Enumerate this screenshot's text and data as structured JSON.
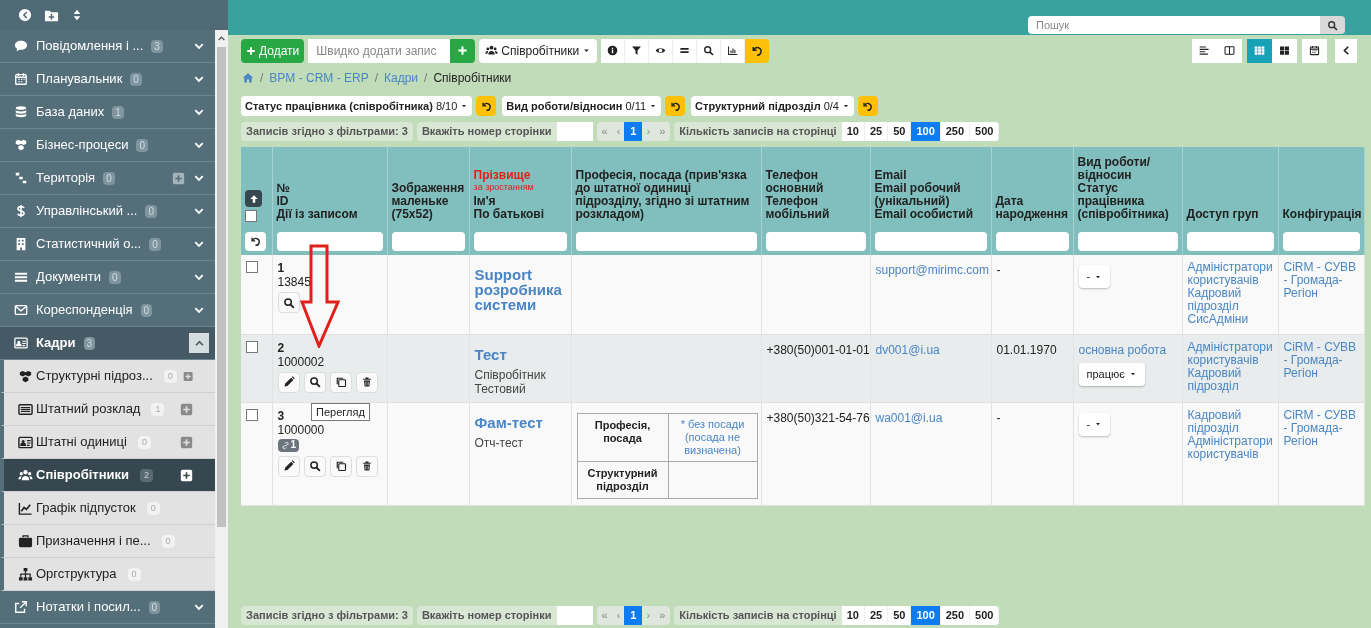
{
  "topbar": {
    "search_placeholder": "Пошук"
  },
  "sidebar": {
    "items": [
      {
        "label": "Повідомлення і ...",
        "count": "3",
        "expanded": false,
        "add": false
      },
      {
        "label": "Планувальник",
        "count": "0",
        "expanded": false,
        "add": false
      },
      {
        "label": "База даних",
        "count": "1",
        "expanded": false,
        "add": false
      },
      {
        "label": "Бізнес-процеси",
        "count": "0",
        "expanded": false,
        "add": false
      },
      {
        "label": "Територія",
        "count": "0",
        "expanded": false,
        "add": true
      },
      {
        "label": "Управлінський ...",
        "count": "0",
        "expanded": false,
        "add": false
      },
      {
        "label": "Статистичний о...",
        "count": "0",
        "expanded": false,
        "add": false
      },
      {
        "label": "Документи",
        "count": "0",
        "expanded": false,
        "add": false
      },
      {
        "label": "Кореспонденція",
        "count": "0",
        "expanded": false,
        "add": false
      },
      {
        "label": "Кадри",
        "count": "3",
        "expanded": true,
        "add": false,
        "children": [
          {
            "label": "Структурні підроз...",
            "count": "0",
            "add": true,
            "selected": false
          },
          {
            "label": "Штатний розклад",
            "count": "1",
            "add": true,
            "selected": false
          },
          {
            "label": "Штатні одиниці",
            "count": "0",
            "add": true,
            "selected": false
          },
          {
            "label": "Співробітники",
            "count": "2",
            "add": true,
            "selected": true
          },
          {
            "label": "Графік підпусток",
            "count": "0",
            "add": false,
            "selected": false
          },
          {
            "label": "Призначення і пе...",
            "count": "0",
            "add": false,
            "selected": false
          },
          {
            "label": "Оргструктура",
            "count": "0",
            "add": false,
            "selected": false
          }
        ]
      },
      {
        "label": "Нотатки і посил...",
        "count": "0",
        "expanded": false,
        "add": false
      }
    ]
  },
  "toolbar": {
    "add_button": "Додати",
    "quick_add_placeholder": "Швидко додати запис",
    "entity_menu": "Співробітники"
  },
  "view_modes": [
    {
      "selected": false
    },
    {
      "selected": false
    },
    {
      "selected": true
    },
    {
      "selected": false
    },
    {
      "selected": false
    }
  ],
  "breadcrumb": {
    "separator": "/",
    "items": [
      {
        "label": "BPM - CRM - ERP",
        "link": true
      },
      {
        "label": "Кадри",
        "link": true
      },
      {
        "label": "Співробітники",
        "link": false
      }
    ]
  },
  "filters": [
    {
      "label": "Статус працівника (співробітника)",
      "value": "8/10"
    },
    {
      "label": "Вид роботи/відносин",
      "value": "0/11"
    },
    {
      "label": "Структурний підрозділ",
      "value": "0/4"
    }
  ],
  "pagination_top": {
    "records": "Записів згідно з фільтрами: 3",
    "page_prompt": "Вкажіть номер сторінки",
    "first": "«",
    "prev": "‹",
    "pages": [
      {
        "label": "1",
        "selected": true
      }
    ],
    "next": "›",
    "last": "»",
    "per_page_label": "Кількість записів на сторінці",
    "per_page": [
      {
        "label": "10",
        "selected": false
      },
      {
        "label": "25",
        "selected": false
      },
      {
        "label": "50",
        "selected": false
      },
      {
        "label": "100",
        "selected": true
      },
      {
        "label": "250",
        "selected": false
      },
      {
        "label": "500",
        "selected": false
      }
    ]
  },
  "table": {
    "select_all": {
      "checked": false
    },
    "columns": [
      {
        "lines": [
          "№",
          "ID",
          "Дії із записом"
        ]
      },
      {
        "lines": [
          "Зображення маленьке (75x52)"
        ]
      },
      {
        "lines": [
          "Прізвище",
          "Ім'я",
          "По батькові"
        ],
        "sorted": true,
        "sort_label": "за зростанням"
      },
      {
        "lines": [
          "Професія, посада (прив'язка до штатної одиниці підрозділу, згідно зі штатним розкладом)"
        ]
      },
      {
        "lines": [
          "Телефон основний",
          "Телефон мобільний"
        ]
      },
      {
        "lines": [
          "Email",
          "Email робочий (унікальний)",
          "Email особистий"
        ]
      },
      {
        "lines": [
          "Дата народження"
        ]
      },
      {
        "lines": [
          "Вид роботи/відносин",
          "Статус працівника (співробітника)"
        ]
      },
      {
        "lines": [
          "Доступ груп"
        ]
      },
      {
        "lines": [
          "Конфігурація"
        ]
      }
    ],
    "rows": [
      {
        "checked": false,
        "highlighted": false,
        "number": "1",
        "id": "13845",
        "actions": [
          {
            "kind": "view"
          }
        ],
        "surname": "Support розробника системи",
        "email": "support@mirimc.com",
        "birth_date": "-",
        "status": "-",
        "access": [
          "Адміністратори користувачів",
          "Кадровий підрозділ",
          "СисАдміни"
        ],
        "configuration": "CiRM - СУВВ - Громада-Регіон"
      },
      {
        "checked": false,
        "highlighted": true,
        "number": "2",
        "id": "1000002",
        "actions": [
          {
            "kind": "edit"
          },
          {
            "kind": "view"
          },
          {
            "kind": "copy"
          },
          {
            "kind": "delete"
          }
        ],
        "surname": "Тест",
        "first_name": "Співробітник",
        "patronymic": "Тестовий",
        "phone": "+380(50)001-01-01",
        "email": "dv001@i.ua",
        "birth_date": "01.01.1970",
        "work_type": "основна робота",
        "status": "працює",
        "access": [
          "Адміністратори користувачів",
          "Кадровий підрозділ"
        ],
        "configuration": "CiRM - СУВВ - Громада-Регіон"
      },
      {
        "checked": false,
        "highlighted": false,
        "number": "3",
        "id": "1000000",
        "links_count": "1",
        "actions": [
          {
            "kind": "edit"
          },
          {
            "kind": "view"
          },
          {
            "kind": "copy"
          },
          {
            "kind": "delete"
          }
        ],
        "surname": "Фам-тест",
        "patronymic": "Отч-тест",
        "profession": [
          {
            "label": "Професія, посада",
            "value": "* без посади (посада не визначена)"
          },
          {
            "label": "Структурний підрозділ"
          }
        ],
        "phone": "+380(50)321-54-76",
        "email": "wa001@i.ua",
        "birth_date": "-",
        "status": "-",
        "access": [
          "Кадровий підрозділ",
          "Адміністратори користувачів"
        ],
        "configuration": "CiRM - СУВВ - Громада-Регіон"
      }
    ]
  },
  "tooltip": "Перегляд",
  "pagination_bottom": {
    "records": "Записів згідно з фільтрами: 3",
    "page_prompt": "Вкажіть номер сторінки",
    "first": "«",
    "prev": "‹",
    "pages": [
      {
        "label": "1",
        "selected": true
      }
    ],
    "next": "›",
    "last": "»",
    "per_page_label": "Кількість записів на сторінці",
    "per_page": [
      {
        "label": "10",
        "selected": false
      },
      {
        "label": "25",
        "selected": false
      },
      {
        "label": "50",
        "selected": false
      },
      {
        "label": "100",
        "selected": true
      },
      {
        "label": "250",
        "selected": false
      },
      {
        "label": "500",
        "selected": false
      }
    ]
  }
}
